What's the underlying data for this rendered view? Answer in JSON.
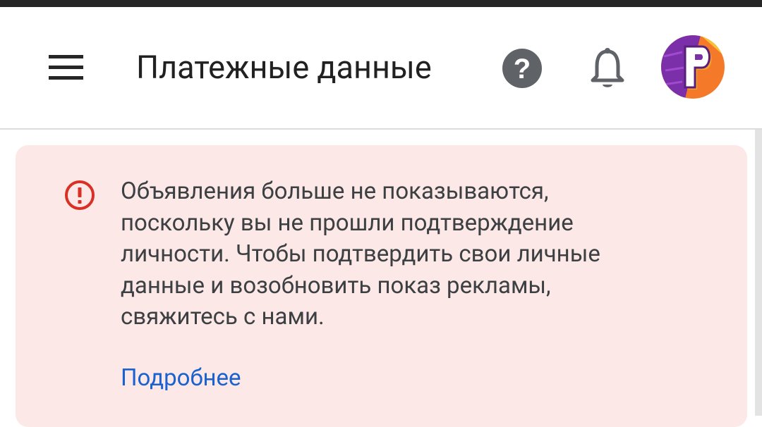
{
  "header": {
    "title": "Платежные данные",
    "menu_icon": "hamburger-menu-icon",
    "help_icon": "help-icon",
    "notifications_icon": "bell-icon",
    "avatar_letter": "P"
  },
  "alert": {
    "icon": "error-exclamation-icon",
    "message": "Объявления больше не показываются, поскольку вы не прошли подтверждение личности. Чтобы подтвердить свои личные данные и возобновить показ рекламы, свяжитесь с нами.",
    "link_label": "Подробнее"
  },
  "colors": {
    "alert_background": "#fce8e6",
    "alert_icon": "#d93025",
    "link": "#1a62d0",
    "icon_gray": "#5f6368",
    "text_primary": "#212121",
    "text_secondary": "#3c4043"
  }
}
